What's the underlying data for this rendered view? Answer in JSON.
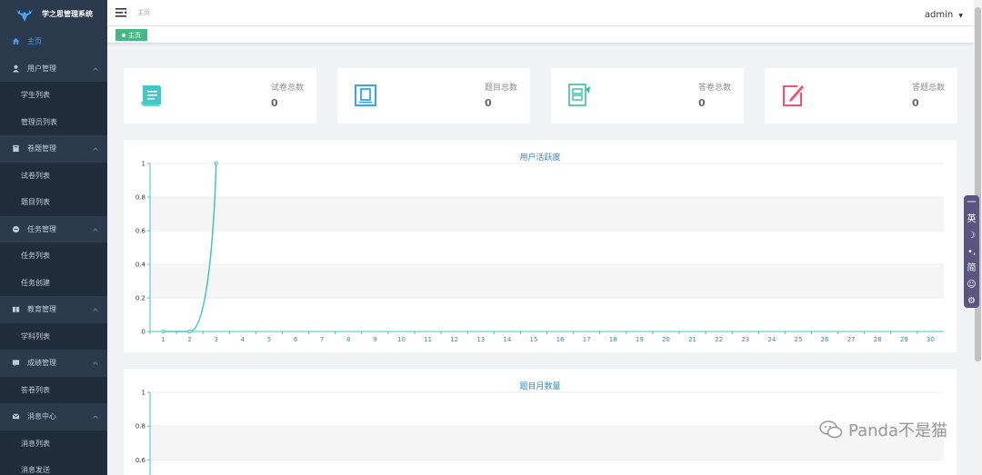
{
  "app": {
    "title": "学之思管理系统"
  },
  "sidebar": {
    "items": [
      {
        "label": "主页",
        "type": "item",
        "icon": "home-icon",
        "active": true
      },
      {
        "label": "用户管理",
        "type": "group",
        "icon": "user-icon"
      },
      {
        "label": "学生列表",
        "type": "sub"
      },
      {
        "label": "管理员列表",
        "type": "sub"
      },
      {
        "label": "卷题管理",
        "type": "group",
        "icon": "book-icon"
      },
      {
        "label": "试卷列表",
        "type": "sub"
      },
      {
        "label": "题目列表",
        "type": "sub"
      },
      {
        "label": "任务管理",
        "type": "group",
        "icon": "task-icon"
      },
      {
        "label": "任务列表",
        "type": "sub"
      },
      {
        "label": "任务创建",
        "type": "sub"
      },
      {
        "label": "教育管理",
        "type": "group",
        "icon": "education-icon"
      },
      {
        "label": "学科列表",
        "type": "sub"
      },
      {
        "label": "成绩管理",
        "type": "group",
        "icon": "score-icon"
      },
      {
        "label": "答卷列表",
        "type": "sub"
      },
      {
        "label": "消息中心",
        "type": "group",
        "icon": "message-icon"
      },
      {
        "label": "消息列表",
        "type": "sub"
      },
      {
        "label": "消息发送",
        "type": "sub"
      }
    ]
  },
  "header": {
    "breadcrumb": "主页",
    "user": "admin"
  },
  "tags": {
    "active": "主页"
  },
  "stats": [
    {
      "label": "试卷总数",
      "value": "0",
      "icon": "scroll-icon",
      "color": "#40c9c6"
    },
    {
      "label": "题目总数",
      "value": "0",
      "icon": "book-open-icon",
      "color": "#36a3f7"
    },
    {
      "label": "答卷总数",
      "value": "0",
      "icon": "answer-sheet-icon",
      "color": "#34bfa3"
    },
    {
      "label": "答题总数",
      "value": "0",
      "icon": "edit-icon",
      "color": "#f4516c"
    }
  ],
  "ime": {
    "items": [
      "一",
      "英",
      "☽",
      "•,",
      "简",
      "☺",
      "⚙"
    ]
  },
  "watermark": {
    "text": "Panda不是猫"
  },
  "chart_data": [
    {
      "type": "line",
      "title": "用户活跃度",
      "x": [
        1,
        2,
        3,
        4,
        5,
        6,
        7,
        8,
        9,
        10,
        11,
        12,
        13,
        14,
        15,
        16,
        17,
        18,
        19,
        20,
        21,
        22,
        23,
        24,
        25,
        26,
        27,
        28,
        29,
        30
      ],
      "series": [
        {
          "values": [
            0,
            0,
            1,
            null,
            null,
            null,
            null,
            null,
            null,
            null,
            null,
            null,
            null,
            null,
            null,
            null,
            null,
            null,
            null,
            null,
            null,
            null,
            null,
            null,
            null,
            null,
            null,
            null,
            null,
            null
          ]
        }
      ],
      "ylim": [
        0,
        1
      ],
      "yticks": [
        "0",
        "0.2",
        "0.4",
        "0.6",
        "0.8",
        "1"
      ],
      "color": "#3ec5c5"
    },
    {
      "type": "line",
      "title": "题目月数量",
      "yticks_visible": [
        "1",
        "0.8",
        "0.6"
      ],
      "ylim": [
        0,
        1
      ],
      "color": "#3ec5c5"
    }
  ]
}
